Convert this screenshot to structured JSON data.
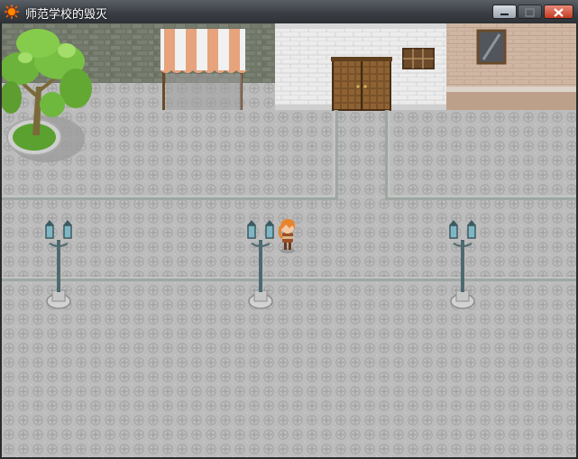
{
  "window": {
    "title": "师范学校的毁灭",
    "icons": {
      "app": "sun-icon",
      "minimize": "minimize-icon",
      "maximize": "maximize-icon",
      "close": "close-icon"
    },
    "colors": {
      "titlebar": "#3b3f45",
      "close": "#c23a22"
    }
  },
  "scene": {
    "type": "town-square-map",
    "colors": {
      "pavement": "#b9b9b9",
      "path": "#c8c8c8",
      "wall_stone": "#6f7568",
      "building_white": "#e9e9e9",
      "building_tan": "#cdb5a2",
      "door": "#6e4a25"
    },
    "objects": [
      "tree",
      "market-awning",
      "double-door",
      "street-lamp",
      "street-lamp",
      "street-lamp",
      "player-character"
    ]
  }
}
